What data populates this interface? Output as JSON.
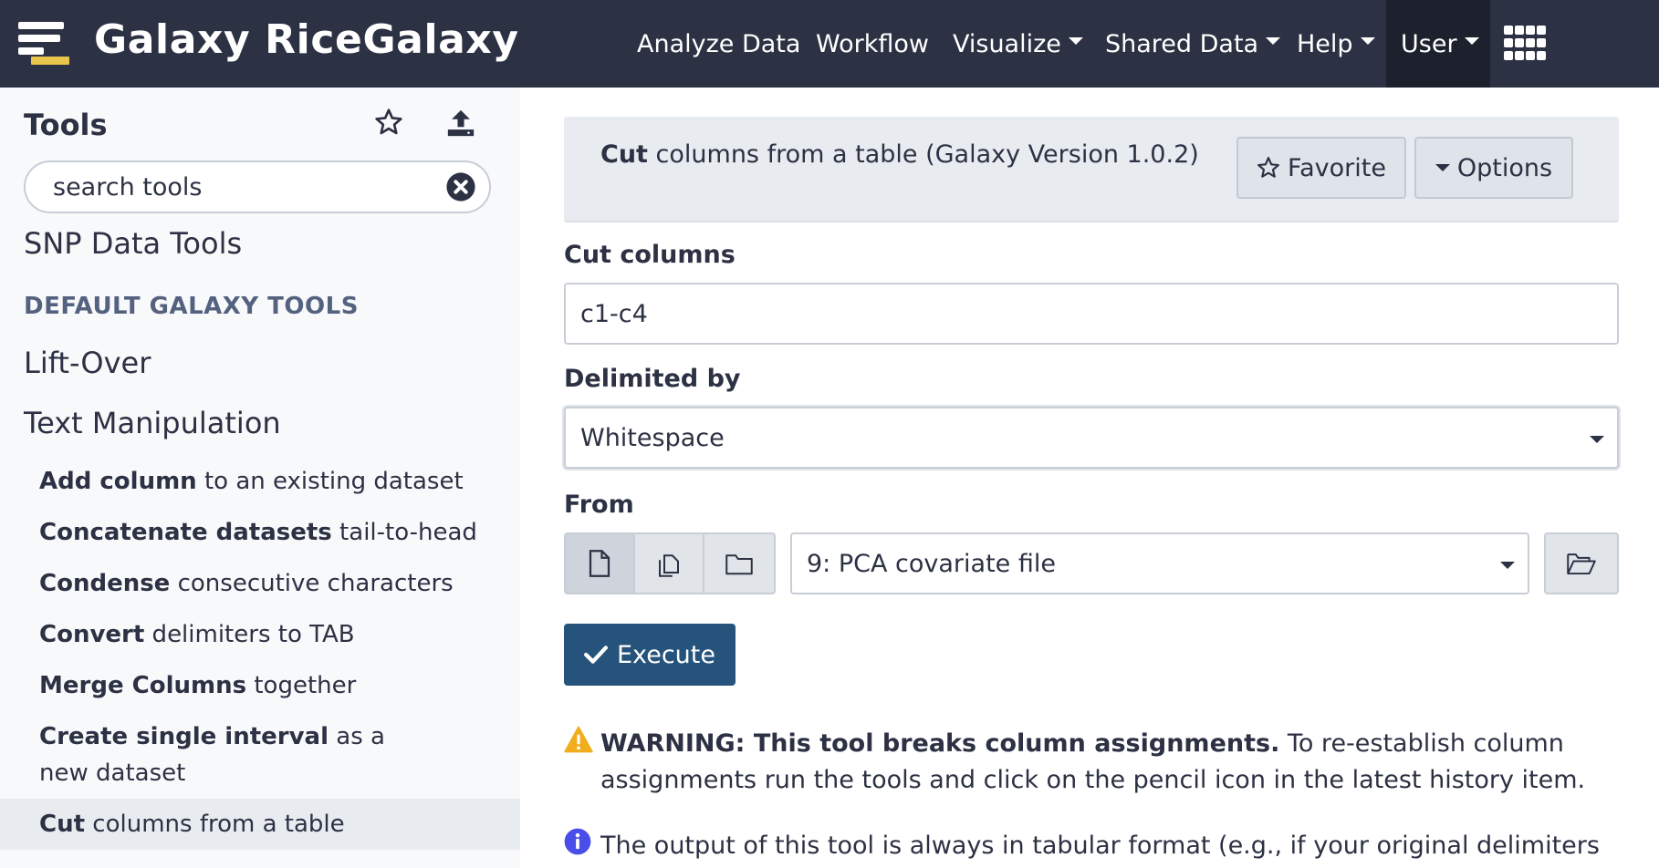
{
  "masthead": {
    "brand": "Galaxy RiceGalaxy",
    "nav": {
      "analyze": "Analyze Data",
      "workflow": "Workflow",
      "visualize": "Visualize",
      "shared": "Shared Data",
      "help": "Help",
      "user": "User"
    },
    "colors": {
      "background": "#2c3143",
      "active": "#1d212d",
      "logo_accent": "#e8c64b"
    }
  },
  "tool_panel": {
    "title": "Tools",
    "search_placeholder": "search tools",
    "sections": {
      "snp": "SNP Data Tools",
      "default_label": "DEFAULT GALAXY TOOLS",
      "liftover": "Lift-Over",
      "text_manipulation": "Text Manipulation"
    },
    "tools": [
      {
        "bold": "Add column",
        "rest": " to an existing dataset"
      },
      {
        "bold": "Concatenate datasets",
        "rest": " tail-to-head"
      },
      {
        "bold": "Condense",
        "rest": " consecutive characters"
      },
      {
        "bold": "Convert",
        "rest": " delimiters to TAB"
      },
      {
        "bold": "Merge Columns",
        "rest": " together"
      },
      {
        "bold": "Create single interval",
        "rest": " as a new dataset"
      },
      {
        "bold": "Cut",
        "rest": " columns from a table"
      }
    ]
  },
  "tool_form": {
    "title_bold": "Cut",
    "title_rest": " columns from a table (Galaxy Version 1.0.2)",
    "favorite_label": "Favorite",
    "options_label": "Options",
    "cut_columns": {
      "label": "Cut columns",
      "value": "c1-c4"
    },
    "delimited_by": {
      "label": "Delimited by",
      "value": "Whitespace"
    },
    "from": {
      "label": "From",
      "value": "9: PCA covariate file"
    },
    "execute_label": "Execute",
    "warning_bold": "WARNING: This tool breaks column assignments.",
    "warning_rest": " To re-establish column assignments run the tools and click on the pencil icon in the latest history item.",
    "info_text": "The output of this tool is always in tabular format (e.g., if your original delimiters are",
    "colors": {
      "execute": "#25537b",
      "warning": "#f0ad1c",
      "info": "#4a4ee8"
    }
  }
}
